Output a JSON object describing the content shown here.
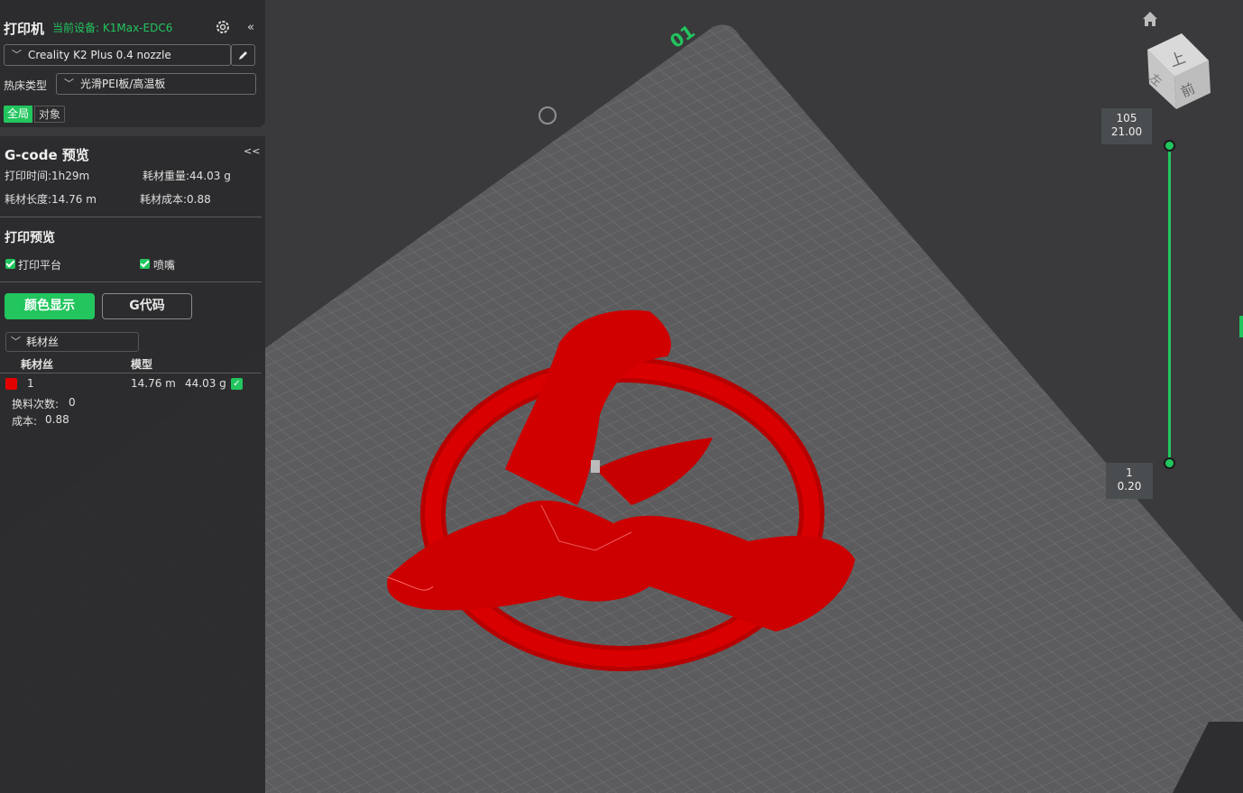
{
  "printer": {
    "title": "打印机",
    "current_device_label": "当前设备: K1Max-EDC6",
    "preset_value": "Creality K2 Plus 0.4 nozzle",
    "bed_type_label": "热床类型",
    "bed_type_value": "光滑PEI板/高温板",
    "tab_global": "全局",
    "tab_object": "对象"
  },
  "gcode": {
    "title": "G-code 预览",
    "collapse_label": "<<",
    "print_time": "打印时间:1h29m",
    "filament_weight": "耗材重量:44.03 g",
    "filament_length": "耗材长度:14.76 m",
    "filament_cost": "耗材成本:0.88"
  },
  "preview": {
    "title": "打印预览",
    "show_plate_label": "打印平台",
    "show_nozzle_label": "喷嘴",
    "color_display_button": "颜色显示",
    "gcode_button": "G代码",
    "filament_dropdown": "耗材丝",
    "table_headers": [
      "耗材丝",
      "模型"
    ],
    "row": {
      "index": "1",
      "length": "14.76 m",
      "weight": "44.03 g",
      "color": "#e50000"
    },
    "changes_label": "换料次数:",
    "changes_value": "0",
    "cost_label": "成本:",
    "cost_value": "0.88"
  },
  "viewport": {
    "plate_label": "01",
    "cube_top": "上",
    "cube_front": "前",
    "cube_left": "左",
    "model_color": "#d40000",
    "accent": "#22c55e"
  },
  "layer_slider": {
    "top_layer": "105",
    "top_height": "21.00",
    "bottom_layer": "1",
    "bottom_height": "0.20"
  }
}
